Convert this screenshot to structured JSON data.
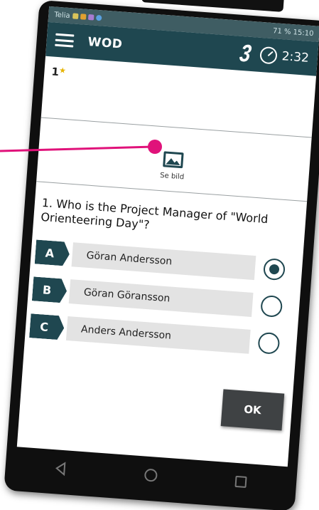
{
  "status_bar": {
    "carrier": "Telia",
    "right_text": "71 % 15:10"
  },
  "app_bar": {
    "title": "WOD",
    "counter": "3",
    "timer": "2:32"
  },
  "points": {
    "value": "1",
    "star": "★"
  },
  "image": {
    "label": "Se bild"
  },
  "question": {
    "text": "1. Who is the Project Manager of \"World Orienteering Day\"?"
  },
  "options": [
    {
      "letter": "A",
      "text": "Göran Andersson",
      "selected": true
    },
    {
      "letter": "B",
      "text": "Göran Göransson",
      "selected": false
    },
    {
      "letter": "C",
      "text": "Anders Andersson",
      "selected": false
    }
  ],
  "ok_button": {
    "label": "OK"
  },
  "colors": {
    "primary": "#1f4750",
    "pointer": "#e0127a",
    "ok": "#3f4244"
  }
}
